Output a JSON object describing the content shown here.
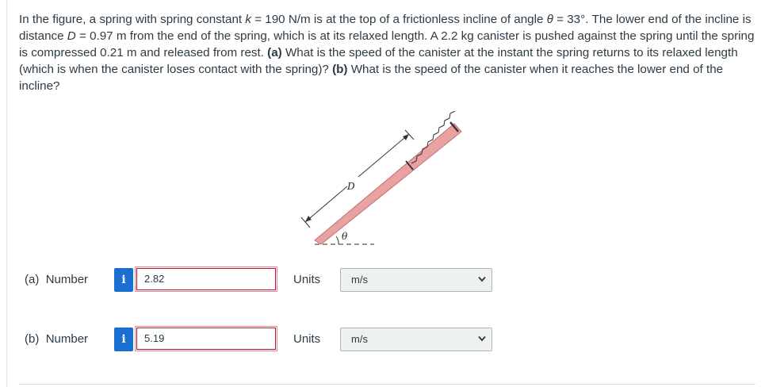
{
  "question": {
    "p1": "In the figure, a spring with spring constant ",
    "k_var": "k",
    "p2": " = 190 N/m is at the top of a frictionless incline of angle ",
    "theta_var": "θ",
    "p3": " = 33°. The lower end of the incline is distance ",
    "d_var": "D",
    "p4": " = 0.97 m from the end of the spring, which is at its relaxed length. A 2.2 kg canister is pushed against the spring until the spring is compressed 0.21 m and released from rest. ",
    "part_a": "(a)",
    "p5": " What is the speed of the canister at the instant the spring returns to its relaxed length (which is when the canister loses contact with the spring)? ",
    "part_b": "(b)",
    "p6": " What is the speed of the canister when it reaches the lower end of the incline?"
  },
  "figure": {
    "distance_label": "D",
    "angle_label": "θ"
  },
  "answers": [
    {
      "part": "(a)",
      "label": "Number",
      "info_icon": "i",
      "value": "2.82",
      "units_label": "Units",
      "units_value": "m/s"
    },
    {
      "part": "(b)",
      "label": "Number",
      "info_icon": "i",
      "value": "5.19",
      "units_label": "Units",
      "units_value": "m/s"
    }
  ],
  "colors": {
    "info_button": "#1a6fd0",
    "invalid_border": "#c8102e",
    "select_background": "#eef2ee",
    "incline_fill": "#e8a2a2"
  }
}
